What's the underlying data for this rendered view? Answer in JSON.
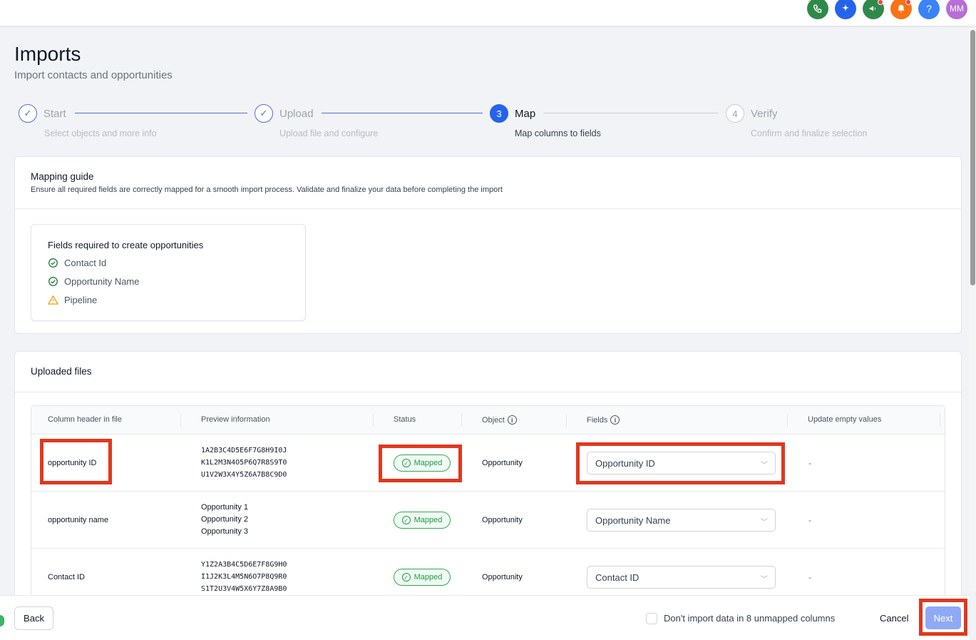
{
  "header": {
    "icons": [
      {
        "name": "phone-icon",
        "glyph": "✆",
        "color": "#2f8a4a"
      },
      {
        "name": "sparkle-icon",
        "glyph": "✦",
        "color": "#2563eb"
      },
      {
        "name": "megaphone-icon",
        "glyph": "📢",
        "color": "#2f8a4a"
      },
      {
        "name": "bell-icon",
        "glyph": "🔔",
        "color": "#f97316"
      },
      {
        "name": "help-icon",
        "glyph": "?",
        "color": "#3b82f6"
      },
      {
        "name": "avatar",
        "glyph": "MM",
        "color": "#b66fd6"
      }
    ]
  },
  "page": {
    "title": "Imports",
    "subtitle": "Import contacts and opportunities"
  },
  "stepper": [
    {
      "num": "✓",
      "label": "Start",
      "desc": "Select objects and more info",
      "state": "done"
    },
    {
      "num": "✓",
      "label": "Upload",
      "desc": "Upload file and configure",
      "state": "done"
    },
    {
      "num": "3",
      "label": "Map",
      "desc": "Map columns to fields",
      "state": "active"
    },
    {
      "num": "4",
      "label": "Verify",
      "desc": "Confirm and finalize selection",
      "state": "todo"
    }
  ],
  "guide": {
    "title": "Mapping guide",
    "subtitle": "Ensure all required fields are correctly mapped for a smooth import process. Validate and finalize your data before completing the import",
    "required_title": "Fields required to create opportunities",
    "required": [
      {
        "label": "Contact Id",
        "status": "ok"
      },
      {
        "label": "Opportunity Name",
        "status": "ok"
      },
      {
        "label": "Pipeline",
        "status": "warning"
      }
    ]
  },
  "files": {
    "title": "Uploaded files",
    "columns": [
      "Column header in file",
      "Preview information",
      "Status",
      "Object",
      "Fields",
      "Update empty values"
    ],
    "rows": [
      {
        "header": "opportunity ID",
        "preview": [
          "1A2B3C4D5E6F7G8H9I0J",
          "K1L2M3N4O5P6Q7R8S9T0",
          "U1V2W3X4Y5Z6A7B8C9D0"
        ],
        "status": "Mapped",
        "object": "Opportunity",
        "field": "Opportunity ID",
        "empty": "-"
      },
      {
        "header": "opportunity name",
        "preview": [
          "Opportunity 1",
          "Opportunity 2",
          "Opportunity 3"
        ],
        "status": "Mapped",
        "object": "Opportunity",
        "field": "Opportunity Name",
        "empty": "-"
      },
      {
        "header": "Contact ID",
        "preview": [
          "Y1Z2A3B4C5D6E7F8G9H0",
          "I1J2K3L4M5N6O7P8Q9R0",
          "S1T2U3V4W5X6Y7Z8A9B0"
        ],
        "status": "Mapped",
        "object": "Opportunity",
        "field": "Contact ID",
        "empty": "-"
      }
    ]
  },
  "footer": {
    "back": "Back",
    "checkbox_label": "Don't import data in 8 unmapped columns",
    "cancel": "Cancel",
    "next": "Next"
  }
}
